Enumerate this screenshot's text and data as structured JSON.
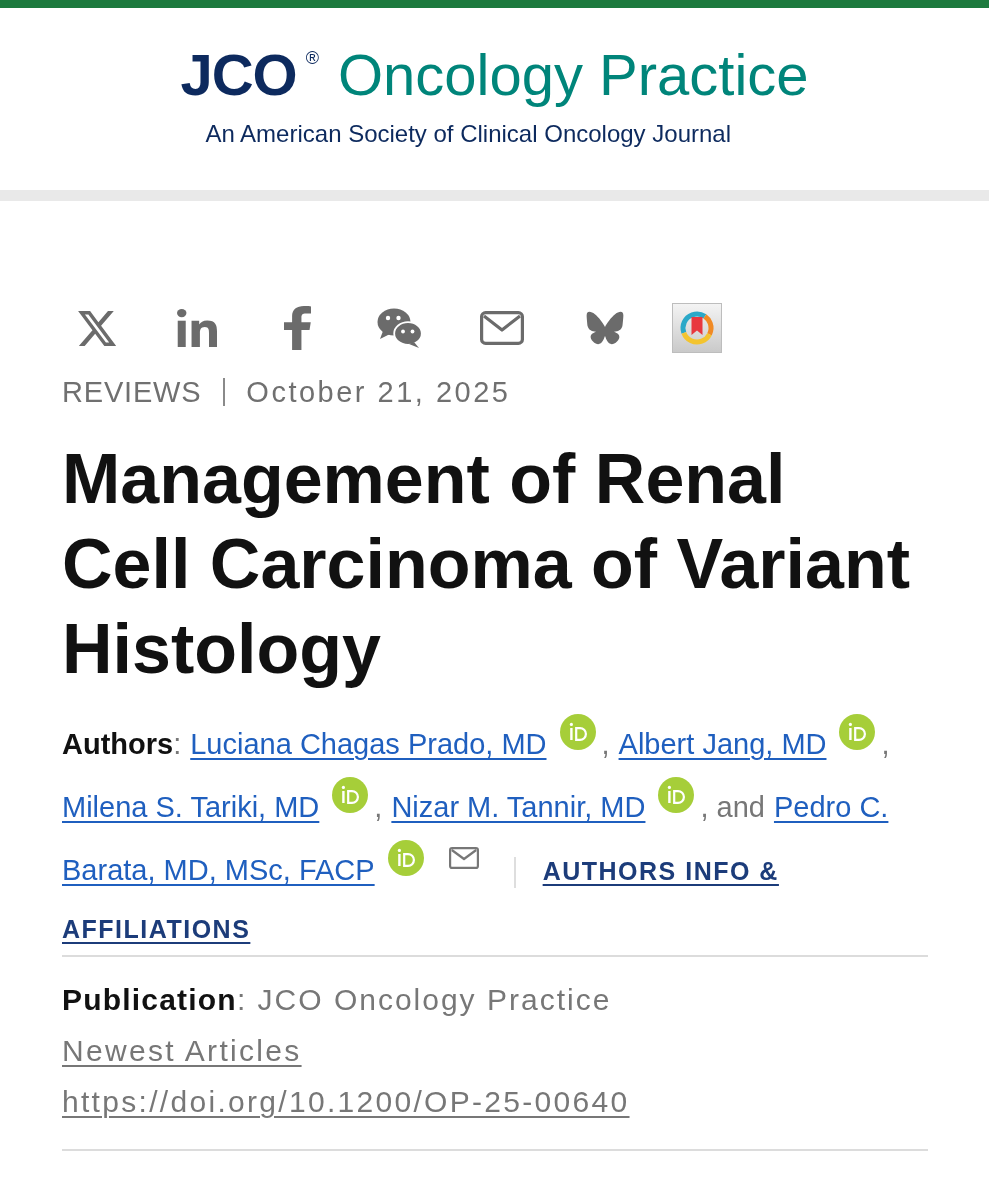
{
  "header": {
    "logo": {
      "mark": "JCO",
      "registered": "®",
      "name": "Oncology Practice",
      "tagline": "An American Society of Clinical Oncology Journal"
    }
  },
  "article": {
    "type": "REVIEWS",
    "date": "October 21, 2025",
    "title": "Management of Renal Cell Carcinoma of Variant Histology"
  },
  "authors": {
    "label": "**Authors**:",
    "people": [
      {
        "name_lines": [
          "Luciana Chagas Prado, MD"
        ],
        "orcid": true,
        "email": false,
        "after": ","
      },
      {
        "name_lines": [
          "Albert Jang, MD"
        ],
        "orcid": true,
        "email": false,
        "after": ","
      },
      {
        "name_lines": [
          "Milena S. Tariki, MD"
        ],
        "orcid": true,
        "email": false,
        "after": ","
      },
      {
        "name_lines": [
          "Nizar M. Tannir, MD"
        ],
        "orcid": true,
        "email": false,
        "after": ", and"
      },
      {
        "name_lines": [
          "Pedro C.",
          "Barata, MD, MSc, FACP"
        ],
        "orcid": true,
        "email": true
      }
    ],
    "info_link_lines": [
      "AUTHORS INFO &",
      "AFFILIATIONS"
    ]
  },
  "publication": {
    "line": "**Publication**: JCO Oncology Practice",
    "section_link": "Newest Articles",
    "doi_link": "https://doi.org/10.1200/OP-25-00640"
  }
}
